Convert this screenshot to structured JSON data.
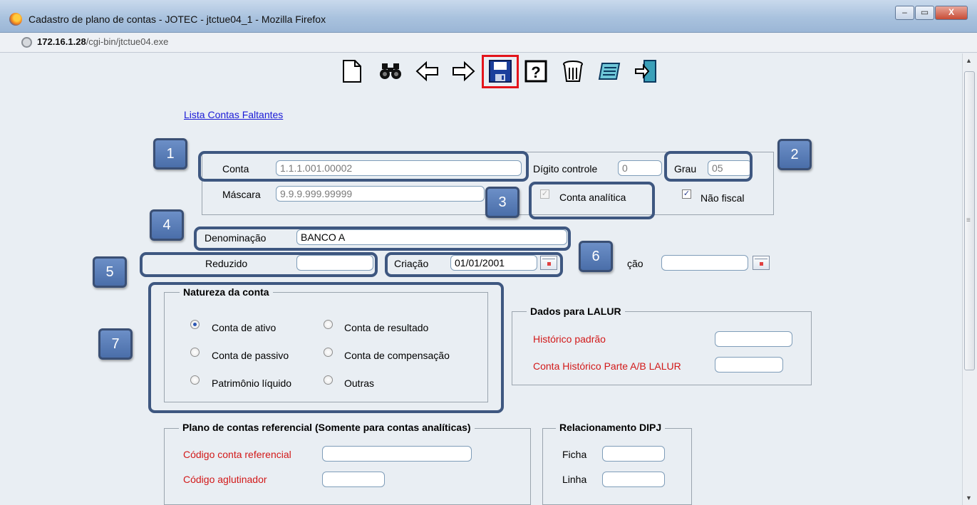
{
  "window": {
    "title": "Cadastro de plano de contas - JOTEC - jtctue04_1 - Mozilla Firefox",
    "url_host": "172.16.1.28",
    "url_path": "/cgi-bin/jtctue04.exe",
    "controls": {
      "minimize": "–",
      "maximize": "▭",
      "close": "X"
    }
  },
  "toolbar": {
    "icons": [
      "new-document-icon",
      "binoculars-search-icon",
      "back-arrow-icon",
      "forward-arrow-icon",
      "save-floppy-icon",
      "help-icon",
      "trash-icon",
      "notes-icon",
      "exit-icon"
    ],
    "highlighted": "save-floppy-icon",
    "highlight_color": "#e3141b"
  },
  "link": {
    "text": "Lista Contas Faltantes"
  },
  "form": {
    "conta_label": "Conta",
    "conta_value": "1.1.1.001.00002",
    "digito_label": "Dígito controle",
    "digito_value": "0",
    "grau_label": "Grau",
    "grau_value": "05",
    "mascara_label": "Máscara",
    "mascara_value": "9.9.9.999.99999",
    "conta_analitica_label": "Conta analítica",
    "conta_analitica_checked": true,
    "nao_fiscal_label": "Não fiscal",
    "nao_fiscal_checked": true,
    "denominacao_label": "Denominação",
    "denominacao_value": "BANCO A",
    "reduzido_label": "Reduzido",
    "reduzido_value": "",
    "criacao_label": "Criação",
    "criacao_value": "01/01/2001",
    "second_date_label_partial": "ção",
    "second_date_value": ""
  },
  "natureza": {
    "legend": "Natureza da conta",
    "options": [
      {
        "label": "Conta de ativo",
        "checked": true
      },
      {
        "label": "Conta de resultado",
        "checked": false
      },
      {
        "label": "Conta de passivo",
        "checked": false
      },
      {
        "label": "Conta de compensação",
        "checked": false
      },
      {
        "label": "Patrimônio líquido",
        "checked": false
      },
      {
        "label": "Outras",
        "checked": false
      }
    ]
  },
  "lalur": {
    "legend": "Dados para LALUR",
    "historico_label": "Histórico padrão",
    "historico_value": "",
    "conta_historico_label": "Conta Histórico Parte A/B LALUR",
    "conta_historico_value": ""
  },
  "referencial": {
    "legend": "Plano de contas referencial (Somente para contas analíticas)",
    "codigo_conta_label": "Código conta referencial",
    "codigo_conta_value": "",
    "codigo_aglutinador_label": "Código aglutinador",
    "codigo_aglutinador_value": ""
  },
  "dipj": {
    "legend": "Relacionamento DIPJ",
    "ficha_label": "Ficha",
    "ficha_value": "",
    "linha_label": "Linha",
    "linha_value": ""
  },
  "callouts": [
    "1",
    "2",
    "3",
    "4",
    "5",
    "6",
    "7"
  ],
  "colors": {
    "label_red": "#d21919",
    "callout_border": "#3e5780",
    "callout_fill": "#5a7db8",
    "link": "#1a1ad6"
  }
}
